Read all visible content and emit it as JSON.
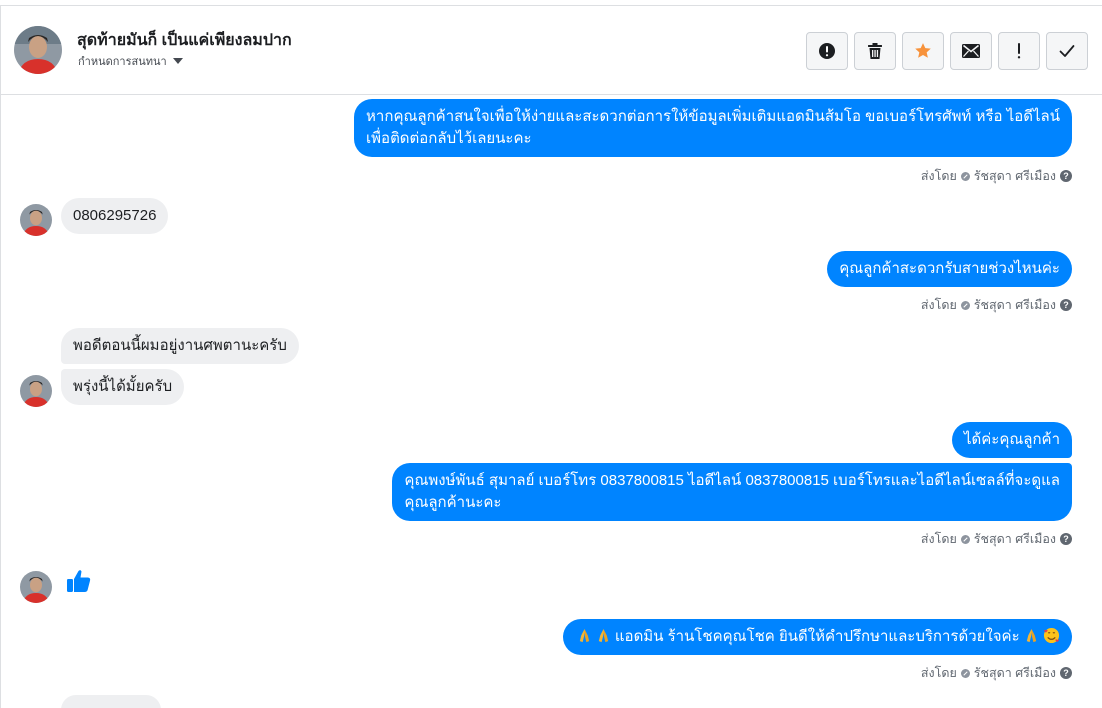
{
  "header": {
    "contact_name": "สุดท้ายมันก็ เป็นแค่เพียงลมปาก",
    "assign_label": "กำหนดการสนทนา"
  },
  "actions": [
    {
      "name": "mark-spam-button",
      "icon": "alert-circle-icon"
    },
    {
      "name": "delete-button",
      "icon": "trash-icon"
    },
    {
      "name": "star-button",
      "icon": "star-icon"
    },
    {
      "name": "mark-unread-button",
      "icon": "envelope-icon"
    },
    {
      "name": "follow-up-button",
      "icon": "exclamation-icon"
    },
    {
      "name": "mark-done-button",
      "icon": "checkmark-icon"
    }
  ],
  "colors": {
    "outgoing_bubble": "#0084ff",
    "incoming_bubble": "#eeeff1",
    "star": "#f7923b",
    "like": "#0084ff"
  },
  "messages": {
    "m1": {
      "line1": "หากคุณลูกค้าสนใจเพื่อให้ง่ายและสะดวกต่อการให้ข้อมูลเพิ่มเติมแอดมินส้มโอ ขอเบอร์โทรศัพท์ หรือ ไอดีไลน์",
      "line2": "เพื่อติดต่อกลับไว้เลยนะคะ"
    },
    "m2": "0806295726",
    "m3": "คุณลูกค้าสะดวกรับสายช่วงไหนค่ะ",
    "m4": "พอดีตอนนี้ผมอยู่งานศพตานะครับ",
    "m5": "พรุ่งนี้ได้มั้ยครับ",
    "m6": "ได้ค่ะคุณลูกค้า",
    "m7": {
      "line1": "คุณพงษ์พันธ์ สุมาลย์      เบอร์โทร 0837800815  ไอดีไลน์ 0837800815  เบอร์โทรและไอดีไลน์เซลล์ที่จะดูแล",
      "line2": "คุณลูกค้านะคะ"
    },
    "m8": "แอดมิน ร้านโชคคุณโชค ยินดีให้คำปรึกษาและบริการด้วยใจค่ะ"
  },
  "sent_by": {
    "prefix": "ส่งโดย",
    "agent": "รัชสุดา ศรีเมือง",
    "help": "?"
  }
}
